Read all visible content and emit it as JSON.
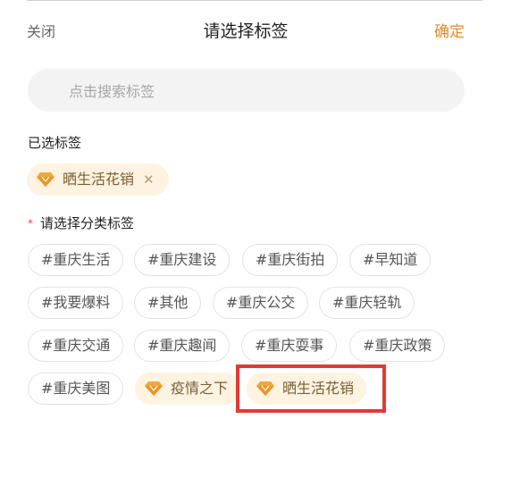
{
  "header": {
    "close_label": "关闭",
    "title": "请选择标签",
    "confirm_label": "确定"
  },
  "search": {
    "placeholder": "点击搜索标签"
  },
  "selected_section": {
    "label": "已选标签",
    "tags": [
      {
        "text": "晒生活花销",
        "icon": "diamond-icon",
        "remove_icon": "close-icon"
      }
    ]
  },
  "category_section": {
    "required_mark": "*",
    "label": "请选择分类标签",
    "rows": [
      [
        "#重庆生活",
        "#重庆建设",
        "#重庆街拍",
        "#早知道"
      ],
      [
        "#我要爆料",
        "#其他",
        "#重庆公交",
        "#重庆轻轨"
      ],
      [
        "#重庆交通",
        "#重庆趣闻",
        "#重庆耍事",
        "#重庆政策"
      ],
      [
        "#重庆美图"
      ]
    ],
    "special_tags": [
      {
        "text": "疫情之下",
        "icon": "diamond-icon"
      },
      {
        "text": "晒生活花销",
        "icon": "diamond-icon",
        "highlighted": true
      }
    ]
  },
  "colors": {
    "accent": "#e98a2a",
    "chip_border": "#e3e3e3",
    "special_chip_bg": "#fdf3e0",
    "diamond": "#f0a83a",
    "highlight_box": "#e53935",
    "required_star": "#e2493d"
  }
}
